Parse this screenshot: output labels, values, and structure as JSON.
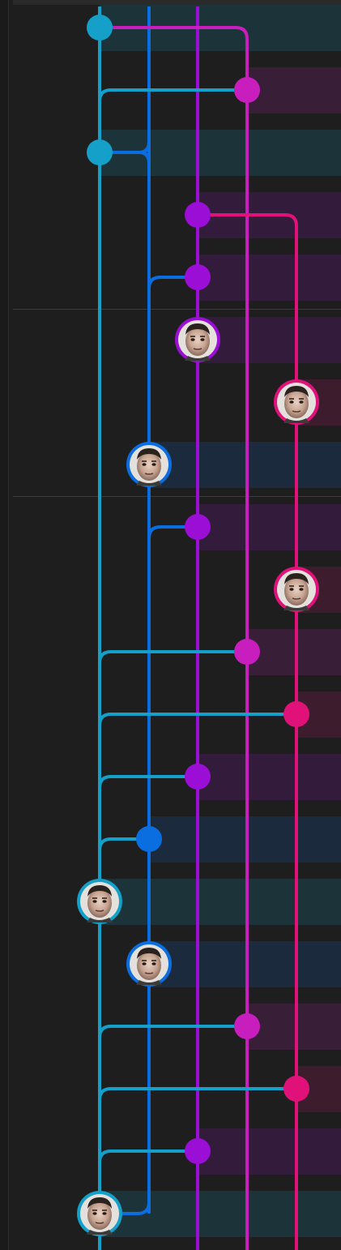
{
  "lane_colors": {
    "lane1": "#14a0c8",
    "lane2": "#0a6de0",
    "lane3": "#9b0ed6",
    "lane4": "#c81ebe",
    "lane5": "#e0127a"
  },
  "separator_rows": [
    5,
    8
  ],
  "commits": [
    {
      "row": 0,
      "lane": 1,
      "kind": "dot"
    },
    {
      "row": 1,
      "lane": 4,
      "kind": "dot"
    },
    {
      "row": 2,
      "lane": 1,
      "kind": "dot"
    },
    {
      "row": 3,
      "lane": 3,
      "kind": "dot"
    },
    {
      "row": 4,
      "lane": 3,
      "kind": "dot"
    },
    {
      "row": 5,
      "lane": 3,
      "kind": "avatar"
    },
    {
      "row": 6,
      "lane": 5,
      "kind": "avatar"
    },
    {
      "row": 7,
      "lane": 2,
      "kind": "avatar"
    },
    {
      "row": 8,
      "lane": 3,
      "kind": "dot"
    },
    {
      "row": 9,
      "lane": 5,
      "kind": "avatar"
    },
    {
      "row": 10,
      "lane": 4,
      "kind": "dot"
    },
    {
      "row": 11,
      "lane": 5,
      "kind": "dot"
    },
    {
      "row": 12,
      "lane": 3,
      "kind": "dot"
    },
    {
      "row": 13,
      "lane": 2,
      "kind": "dot"
    },
    {
      "row": 14,
      "lane": 1,
      "kind": "avatar"
    },
    {
      "row": 15,
      "lane": 2,
      "kind": "avatar"
    },
    {
      "row": 16,
      "lane": 4,
      "kind": "dot"
    },
    {
      "row": 17,
      "lane": 5,
      "kind": "dot"
    },
    {
      "row": 18,
      "lane": 3,
      "kind": "dot"
    },
    {
      "row": 19,
      "lane": 1,
      "kind": "avatar"
    }
  ],
  "merges": [
    {
      "row": 0,
      "from": 1,
      "to": 4
    },
    {
      "row": 1,
      "from": 1,
      "to": 4
    },
    {
      "row": 2,
      "from": 1,
      "to": 2
    },
    {
      "row": 3,
      "from": 3,
      "to": 5
    },
    {
      "row": 4,
      "from": 2,
      "to": 3
    },
    {
      "row": 8,
      "from": 2,
      "to": 3
    },
    {
      "row": 10,
      "from": 1,
      "to": 4
    },
    {
      "row": 11,
      "from": 1,
      "to": 5
    },
    {
      "row": 12,
      "from": 1,
      "to": 3
    },
    {
      "row": 13,
      "from": 1,
      "to": 2
    },
    {
      "row": 16,
      "from": 1,
      "to": 4
    },
    {
      "row": 17,
      "from": 1,
      "to": 5
    },
    {
      "row": 18,
      "from": 1,
      "to": 3
    },
    {
      "row": 19,
      "from": 1,
      "to": 2
    }
  ]
}
